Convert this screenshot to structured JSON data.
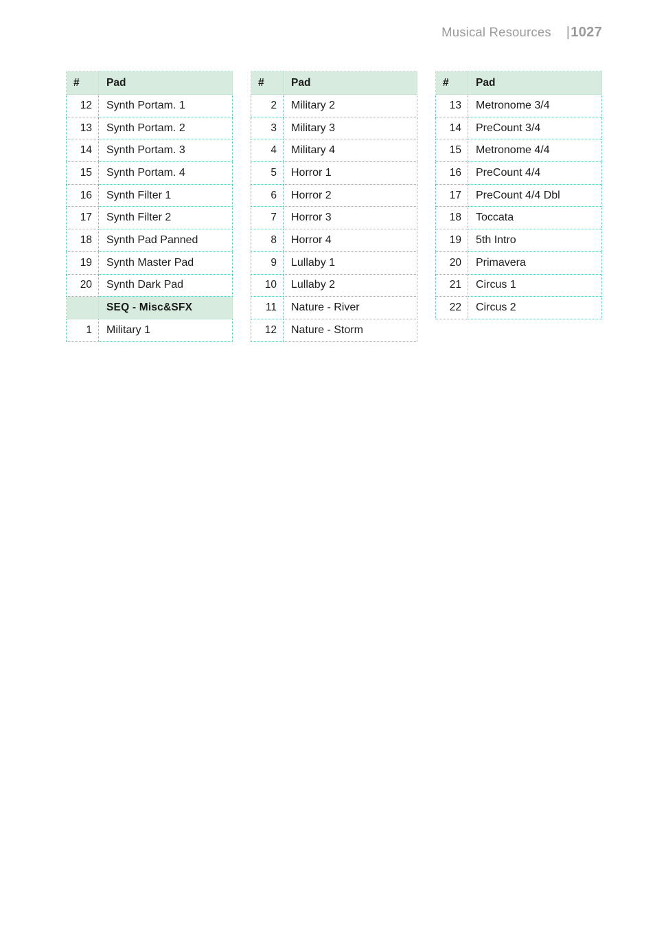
{
  "header": {
    "title": "Musical Resources",
    "page_bar": "|",
    "page_number": "1027"
  },
  "tables": [
    {
      "name": "table-column-1",
      "columns": [
        "#",
        "Pad"
      ],
      "rows": [
        {
          "type": "data",
          "num": "12",
          "pad": "Synth Portam. 1"
        },
        {
          "type": "data",
          "num": "13",
          "pad": "Synth Portam. 2"
        },
        {
          "type": "data",
          "num": "14",
          "pad": "Synth Portam. 3"
        },
        {
          "type": "data",
          "num": "15",
          "pad": "Synth Portam. 4"
        },
        {
          "type": "data",
          "num": "16",
          "pad": "Synth Filter 1"
        },
        {
          "type": "data",
          "num": "17",
          "pad": "Synth Filter 2"
        },
        {
          "type": "data",
          "num": "18",
          "pad": "Synth Pad Panned"
        },
        {
          "type": "data",
          "num": "19",
          "pad": "Synth Master Pad"
        },
        {
          "type": "data",
          "num": "20",
          "pad": "Synth Dark Pad"
        },
        {
          "type": "section",
          "num": "",
          "pad": "SEQ - Misc&SFX"
        },
        {
          "type": "data",
          "num": "1",
          "pad": "Military 1"
        }
      ]
    },
    {
      "name": "table-column-2",
      "columns": [
        "#",
        "Pad"
      ],
      "rows": [
        {
          "type": "data",
          "num": "2",
          "pad": "Military 2"
        },
        {
          "type": "data",
          "num": "3",
          "pad": "Military 3"
        },
        {
          "type": "data",
          "num": "4",
          "pad": "Military 4"
        },
        {
          "type": "data",
          "num": "5",
          "pad": "Horror 1"
        },
        {
          "type": "data",
          "num": "6",
          "pad": "Horror 2"
        },
        {
          "type": "data",
          "num": "7",
          "pad": "Horror 3"
        },
        {
          "type": "data",
          "num": "8",
          "pad": "Horror 4"
        },
        {
          "type": "data",
          "num": "9",
          "pad": "Lullaby 1"
        },
        {
          "type": "data",
          "num": "10",
          "pad": "Lullaby 2"
        },
        {
          "type": "data",
          "num": "11",
          "pad": "Nature - River"
        },
        {
          "type": "data",
          "num": "12",
          "pad": "Nature - Storm"
        }
      ]
    },
    {
      "name": "table-column-3",
      "columns": [
        "#",
        "Pad"
      ],
      "rows": [
        {
          "type": "data",
          "num": "13",
          "pad": "Metronome 3/4"
        },
        {
          "type": "data",
          "num": "14",
          "pad": "PreCount 3/4"
        },
        {
          "type": "data",
          "num": "15",
          "pad": "Metronome 4/4"
        },
        {
          "type": "data",
          "num": "16",
          "pad": "PreCount 4/4"
        },
        {
          "type": "data",
          "num": "17",
          "pad": "PreCount 4/4 Dbl"
        },
        {
          "type": "data",
          "num": "18",
          "pad": "Toccata"
        },
        {
          "type": "data",
          "num": "19",
          "pad": "5th Intro"
        },
        {
          "type": "data",
          "num": "20",
          "pad": "Primavera"
        },
        {
          "type": "data",
          "num": "21",
          "pad": "Circus 1"
        },
        {
          "type": "data",
          "num": "22",
          "pad": "Circus 2"
        }
      ]
    }
  ],
  "colors": {
    "header_band": "#d7ecdf",
    "rule_dotted": "#57c4b2",
    "header_text": "#9a9a9a",
    "body_text": "#1e1e1e"
  }
}
